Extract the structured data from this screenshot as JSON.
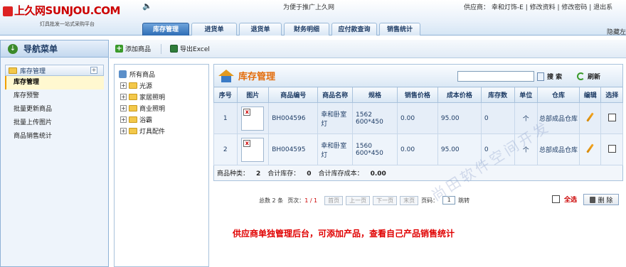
{
  "header": {
    "logo_cn": "上久网",
    "logo_en": "SUNJOU.COM",
    "slogan": "灯具批发一站式采购平台",
    "welcome": "为便于推广上久网",
    "supplier_label": "供应商：",
    "supplier_name": "幸和灯饰-E",
    "edit_profile": "修改资料",
    "change_password": "修改密码",
    "logout": "退出系",
    "hide_left": "隐藏左",
    "nav_tabs": [
      {
        "label": "库存管理",
        "active": true
      },
      {
        "label": "进货单",
        "active": false
      },
      {
        "label": "退货单",
        "active": false
      },
      {
        "label": "财务明细",
        "active": false
      },
      {
        "label": "应付款查询",
        "active": false
      },
      {
        "label": "销售统计",
        "active": false
      }
    ]
  },
  "sidebar": {
    "title": "导航菜单",
    "section": "库存管理",
    "items": [
      {
        "label": "库存管理",
        "active": true
      },
      {
        "label": "库存预警",
        "active": false
      },
      {
        "label": "批量更新商品",
        "active": false
      },
      {
        "label": "批量上传图片",
        "active": false
      },
      {
        "label": "商品销售统计",
        "active": false
      }
    ]
  },
  "toolbar": {
    "add_label": "添加商品",
    "export_label": "导出Excel"
  },
  "tree": {
    "root": "所有商品",
    "nodes": [
      "光源",
      "家居照明",
      "商业照明",
      "浴霸",
      "灯具配件"
    ]
  },
  "panel": {
    "title": "库存管理",
    "search_value": "",
    "search_label": "搜 索",
    "refresh_label": "刷新",
    "columns": [
      "序号",
      "图片",
      "商品编号",
      "商品名称",
      "规格",
      "销售价格",
      "成本价格",
      "库存数",
      "单位",
      "仓库",
      "编辑",
      "选择"
    ],
    "rows": [
      {
        "no": "1",
        "code": "BH004596",
        "name": "幸和卧室灯",
        "spec": "1562 600*450",
        "sale_price": "0.00",
        "cost_price": "95.00",
        "stock": "0",
        "unit": "个",
        "warehouse": "总部成品仓库"
      },
      {
        "no": "2",
        "code": "BH004595",
        "name": "幸和卧室灯",
        "spec": "1560 600*450",
        "sale_price": "0.00",
        "cost_price": "95.00",
        "stock": "0",
        "unit": "个",
        "warehouse": "总部成品仓库"
      }
    ],
    "summary": {
      "kinds_label": "商品种类：",
      "kinds": "2",
      "stock_label": "合计库存：",
      "stock": "0",
      "cost_label": "合计库存成本：",
      "cost": "0.00"
    }
  },
  "pager": {
    "total_text": "总数 2 条",
    "pages_label": "页次：",
    "page_value": "1 / 1",
    "first": "首页",
    "prev": "上一页",
    "next": "下一页",
    "last": "末页",
    "goto_label": "页码：",
    "goto_value": "1",
    "jump": "跳转"
  },
  "actions": {
    "select_all": "全选",
    "delete": "删 除"
  },
  "promo_text": "供应商单独管理后台，可添加产品，查看自己产品销售统计",
  "watermark_text": "尚田软件空间开发"
}
